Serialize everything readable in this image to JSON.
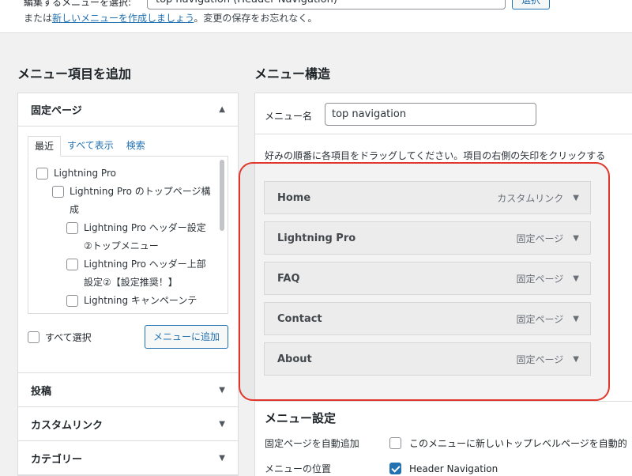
{
  "top": {
    "label": "編集するメニューを選択:",
    "select_value": "top navigation (Header Navigation)",
    "select_button": "選択",
    "note_prefix": "または",
    "note_link": "新しいメニューを作成しましょう",
    "note_suffix": "。変更の保存をお忘れなく。"
  },
  "left": {
    "heading": "メニュー項目を追加",
    "section_title": "固定ページ",
    "tabs": [
      "最近",
      "すべて表示",
      "検索"
    ],
    "pages": [
      {
        "label": "Lightning Pro"
      },
      {
        "label": "Lightning Pro のトップページ構成"
      },
      {
        "label": "Lightning Pro ヘッダー設定②トップメニュー"
      },
      {
        "label": "Lightning Pro ヘッダー上部設定②【設定推奨！】"
      },
      {
        "label": "Lightning キャンペーンテ"
      }
    ],
    "select_all": "すべて選択",
    "add_button": "メニューに追加",
    "other_sections": [
      "投稿",
      "カスタムリンク",
      "カテゴリー"
    ]
  },
  "right": {
    "heading": "メニュー構造",
    "name_label": "メニュー名",
    "name_value": "top navigation",
    "hint": "好みの順番に各項目をドラッグしてください。項目の右側の矢印をクリックする",
    "items": [
      {
        "title": "Home",
        "type": "カスタムリンク"
      },
      {
        "title": "Lightning Pro",
        "type": "固定ページ"
      },
      {
        "title": "FAQ",
        "type": "固定ページ"
      },
      {
        "title": "Contact",
        "type": "固定ページ"
      },
      {
        "title": "About",
        "type": "固定ページ"
      }
    ],
    "settings_title": "メニュー設定",
    "auto_add_label": "固定ページを自動追加",
    "auto_add_text": "このメニューに新しいトップレベルページを自動的",
    "location_label": "メニューの位置",
    "location_text": "Header Navigation"
  },
  "icons": {
    "arrow_down": "▼",
    "arrow_up": "▲"
  },
  "colors": {
    "accent": "#2271b1",
    "highlight": "#e0362b"
  }
}
